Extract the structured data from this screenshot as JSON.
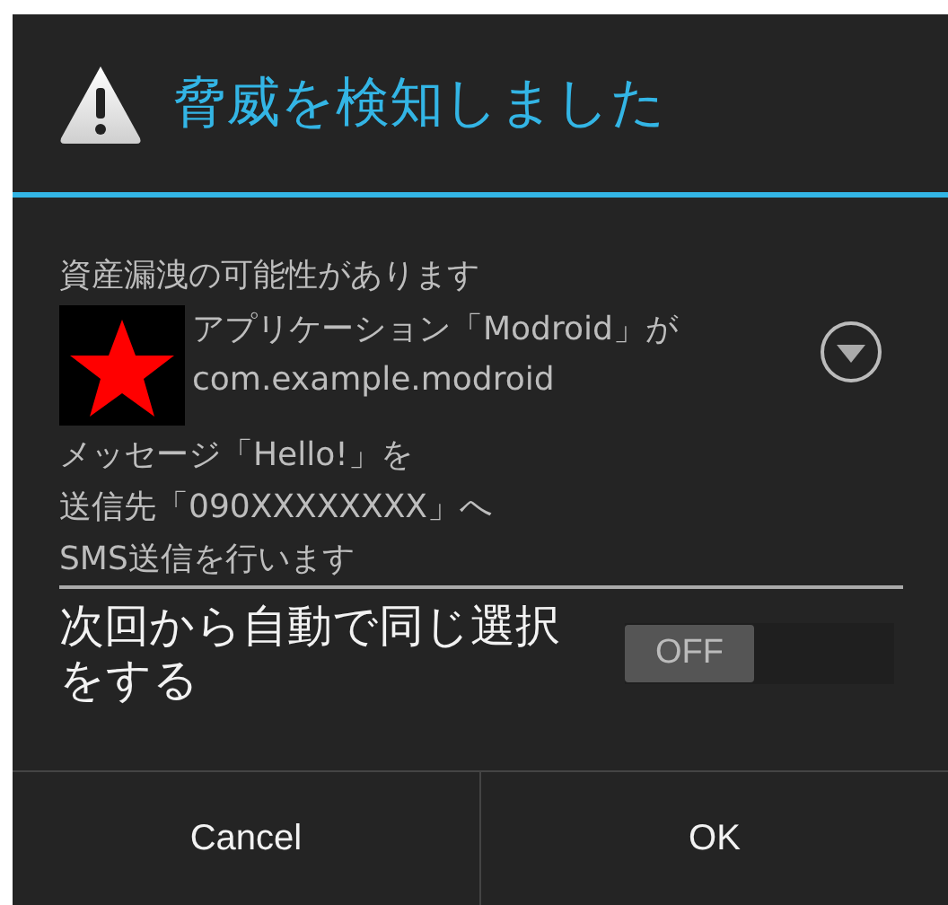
{
  "dialog": {
    "title": "脅威を検知しました",
    "risk": "資産漏洩の可能性があります",
    "app": {
      "description": "アプリケーション「Modroid」が",
      "package": "com.example.modroid",
      "expanded": false
    },
    "message_lines": [
      "メッセージ「Hello!」を",
      "送信先「090XXXXXXXX」へ",
      "SMS送信を行います"
    ],
    "remember": {
      "label": "次回から自動で同じ選択をする",
      "on": false,
      "state_text": "OFF"
    },
    "buttons": [
      "Cancel",
      "OK"
    ]
  }
}
